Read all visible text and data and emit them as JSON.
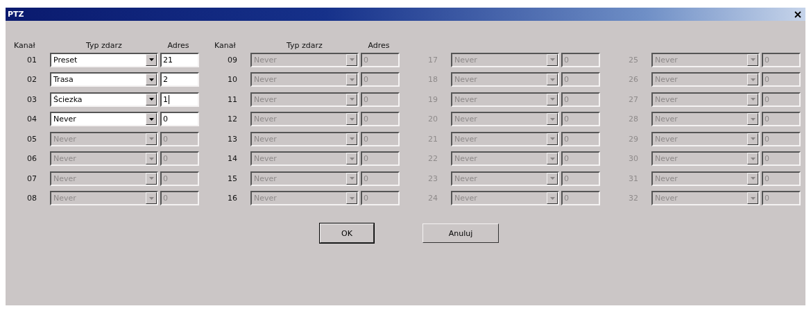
{
  "window": {
    "title": "PTZ"
  },
  "column_headers": [
    {
      "channel": "Kanał",
      "type": "Typ zdarz",
      "address": "Adres"
    },
    {
      "channel": "Kanał",
      "type": "Typ zdarz",
      "address": "Adres"
    }
  ],
  "channels": [
    {
      "number": "01",
      "type": "Preset",
      "address": "21",
      "disabled": false,
      "label_greyed": false,
      "focused": false
    },
    {
      "number": "02",
      "type": "Trasa",
      "address": "2",
      "disabled": false,
      "label_greyed": false,
      "focused": false
    },
    {
      "number": "03",
      "type": "Ściezka",
      "address": "1",
      "disabled": false,
      "label_greyed": false,
      "focused": true
    },
    {
      "number": "04",
      "type": "Never",
      "address": "0",
      "disabled": false,
      "label_greyed": false,
      "focused": false
    },
    {
      "number": "05",
      "type": "Never",
      "address": "0",
      "disabled": true,
      "label_greyed": false,
      "focused": false
    },
    {
      "number": "06",
      "type": "Never",
      "address": "0",
      "disabled": true,
      "label_greyed": false,
      "focused": false
    },
    {
      "number": "07",
      "type": "Never",
      "address": "0",
      "disabled": true,
      "label_greyed": false,
      "focused": false
    },
    {
      "number": "08",
      "type": "Never",
      "address": "0",
      "disabled": true,
      "label_greyed": false,
      "focused": false
    },
    {
      "number": "09",
      "type": "Never",
      "address": "0",
      "disabled": true,
      "label_greyed": false,
      "focused": false
    },
    {
      "number": "10",
      "type": "Never",
      "address": "0",
      "disabled": true,
      "label_greyed": false,
      "focused": false
    },
    {
      "number": "11",
      "type": "Never",
      "address": "0",
      "disabled": true,
      "label_greyed": false,
      "focused": false
    },
    {
      "number": "12",
      "type": "Never",
      "address": "0",
      "disabled": true,
      "label_greyed": false,
      "focused": false
    },
    {
      "number": "13",
      "type": "Never",
      "address": "0",
      "disabled": true,
      "label_greyed": false,
      "focused": false
    },
    {
      "number": "14",
      "type": "Never",
      "address": "0",
      "disabled": true,
      "label_greyed": false,
      "focused": false
    },
    {
      "number": "15",
      "type": "Never",
      "address": "0",
      "disabled": true,
      "label_greyed": false,
      "focused": false
    },
    {
      "number": "16",
      "type": "Never",
      "address": "0",
      "disabled": true,
      "label_greyed": false,
      "focused": false
    },
    {
      "number": "17",
      "type": "Never",
      "address": "0",
      "disabled": true,
      "label_greyed": true,
      "focused": false
    },
    {
      "number": "18",
      "type": "Never",
      "address": "0",
      "disabled": true,
      "label_greyed": true,
      "focused": false
    },
    {
      "number": "19",
      "type": "Never",
      "address": "0",
      "disabled": true,
      "label_greyed": true,
      "focused": false
    },
    {
      "number": "20",
      "type": "Never",
      "address": "0",
      "disabled": true,
      "label_greyed": true,
      "focused": false
    },
    {
      "number": "21",
      "type": "Never",
      "address": "0",
      "disabled": true,
      "label_greyed": true,
      "focused": false
    },
    {
      "number": "22",
      "type": "Never",
      "address": "0",
      "disabled": true,
      "label_greyed": true,
      "focused": false
    },
    {
      "number": "23",
      "type": "Never",
      "address": "0",
      "disabled": true,
      "label_greyed": true,
      "focused": false
    },
    {
      "number": "24",
      "type": "Never",
      "address": "0",
      "disabled": true,
      "label_greyed": true,
      "focused": false
    },
    {
      "number": "25",
      "type": "Never",
      "address": "0",
      "disabled": true,
      "label_greyed": true,
      "focused": false
    },
    {
      "number": "26",
      "type": "Never",
      "address": "0",
      "disabled": true,
      "label_greyed": true,
      "focused": false
    },
    {
      "number": "27",
      "type": "Never",
      "address": "0",
      "disabled": true,
      "label_greyed": true,
      "focused": false
    },
    {
      "number": "28",
      "type": "Never",
      "address": "0",
      "disabled": true,
      "label_greyed": true,
      "focused": false
    },
    {
      "number": "29",
      "type": "Never",
      "address": "0",
      "disabled": true,
      "label_greyed": true,
      "focused": false
    },
    {
      "number": "30",
      "type": "Never",
      "address": "0",
      "disabled": true,
      "label_greyed": true,
      "focused": false
    },
    {
      "number": "31",
      "type": "Never",
      "address": "0",
      "disabled": true,
      "label_greyed": true,
      "focused": false
    },
    {
      "number": "32",
      "type": "Never",
      "address": "0",
      "disabled": true,
      "label_greyed": true,
      "focused": false
    }
  ],
  "buttons": [
    {
      "label": "OK",
      "default": true
    },
    {
      "label": "Anuluj",
      "default": false
    }
  ]
}
